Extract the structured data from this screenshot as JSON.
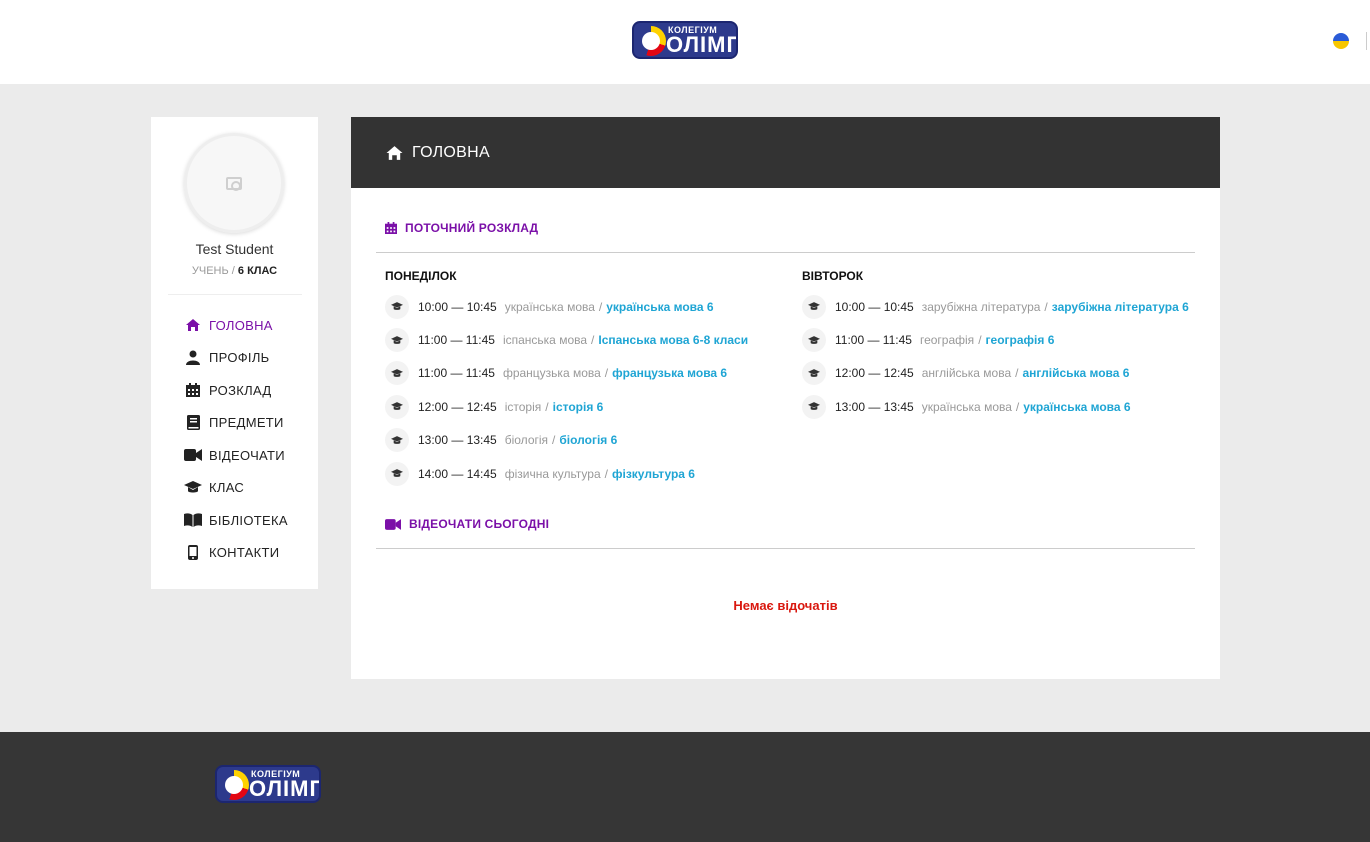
{
  "brand": {
    "small": "КОЛЕГІУМ",
    "big": "ОЛІМП"
  },
  "language": {
    "flag": "ukraine-flag"
  },
  "user": {
    "name": "Test Student",
    "role": "УЧЕНЬ",
    "role_sep": "/",
    "class": "6 КЛАС"
  },
  "nav": {
    "items": [
      {
        "label": "ГОЛОВНА",
        "icon": "home-icon",
        "active": true
      },
      {
        "label": "ПРОФІЛЬ",
        "icon": "user-icon"
      },
      {
        "label": "РОЗКЛАД",
        "icon": "calendar-icon"
      },
      {
        "label": "ПРЕДМЕТИ",
        "icon": "book-icon"
      },
      {
        "label": "ВІДЕОЧАТИ",
        "icon": "video-icon"
      },
      {
        "label": "КЛАС",
        "icon": "graduation-cap-icon"
      },
      {
        "label": "БІБЛІОТЕКА",
        "icon": "open-book-icon"
      },
      {
        "label": "КОНТАКТИ",
        "icon": "phone-icon"
      }
    ]
  },
  "main": {
    "title": "ГОЛОВНА",
    "schedule_title": "ПОТОЧНИЙ РОЗКЛАД",
    "days": [
      {
        "name": "ПОНЕДІЛОК",
        "lessons": [
          {
            "time": "10:00 — 10:45",
            "subject": "українська мова",
            "link": "українська мова 6"
          },
          {
            "time": "11:00 — 11:45",
            "subject": "іспанська мова",
            "link": "Іспанська мова 6-8 класи"
          },
          {
            "time": "11:00 — 11:45",
            "subject": "французька мова",
            "link": "французька мова 6"
          },
          {
            "time": "12:00 — 12:45",
            "subject": "історія",
            "link": "історія 6"
          },
          {
            "time": "13:00 — 13:45",
            "subject": "біологія",
            "link": "біологія 6"
          },
          {
            "time": "14:00 — 14:45",
            "subject": "фізична культура",
            "link": "фізкультура 6"
          }
        ]
      },
      {
        "name": "ВІВТОРОК",
        "lessons": [
          {
            "time": "10:00 — 10:45",
            "subject": "зарубіжна література",
            "link": "зарубіжна література 6"
          },
          {
            "time": "11:00 — 11:45",
            "subject": "географія",
            "link": "географія 6"
          },
          {
            "time": "12:00 — 12:45",
            "subject": "англійська мова ",
            "link": "англійська мова 6"
          },
          {
            "time": "13:00 — 13:45",
            "subject": "українська мова",
            "link": "українська мова 6"
          }
        ]
      }
    ],
    "videochats_title": "ВІДЕОЧАТИ СЬОГОДНІ",
    "videochats_empty": "Немає відочатів"
  },
  "colors": {
    "accent": "#7b10a8",
    "link": "#1fa5d4",
    "danger": "#d9180f",
    "dark": "#333333"
  }
}
